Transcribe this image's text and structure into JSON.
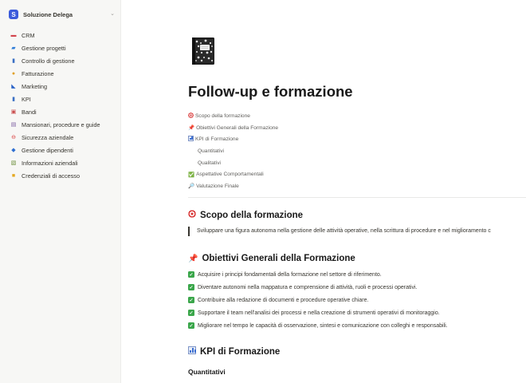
{
  "sidebar": {
    "workspace_name": "Soluzione Delega",
    "workspace_logo": "S",
    "items": [
      {
        "icon": "red-box-icon",
        "label": "CRM",
        "glyph": "▬",
        "color": "#d1434b"
      },
      {
        "icon": "folder-icon",
        "label": "Gestione progetti",
        "glyph": "▰",
        "color": "#2f7dd8"
      },
      {
        "icon": "chart-icon",
        "label": "Controllo di gestione",
        "glyph": "▮",
        "color": "#3a6fc4"
      },
      {
        "icon": "money-bag-icon",
        "label": "Fatturazione",
        "glyph": "●",
        "color": "#e0a12a"
      },
      {
        "icon": "megaphone-icon",
        "label": "Marketing",
        "glyph": "◣",
        "color": "#2b63c7"
      },
      {
        "icon": "bar-chart-icon",
        "label": "KPI",
        "glyph": "▮",
        "color": "#3a6fc4"
      },
      {
        "icon": "calendar-icon",
        "label": "Bandi",
        "glyph": "▣",
        "color": "#c94b4b"
      },
      {
        "icon": "book-icon",
        "label": "Mansionari, procedure e guide",
        "glyph": "▤",
        "color": "#7a5a9e"
      },
      {
        "icon": "no-entry-icon",
        "label": "Sicurezza aziendale",
        "glyph": "⊖",
        "color": "#d93b3b"
      },
      {
        "icon": "people-icon",
        "label": "Gestione dipendenti",
        "glyph": "◆",
        "color": "#2f6fd1"
      },
      {
        "icon": "memo-icon",
        "label": "Informazioni aziendali",
        "glyph": "▧",
        "color": "#6b8e3a"
      },
      {
        "icon": "lock-icon",
        "label": "Credenziali di accesso",
        "glyph": "■",
        "color": "#e4a821"
      }
    ]
  },
  "page": {
    "icon": "composition-notebook-icon",
    "title": "Follow-up e formazione",
    "toc": [
      {
        "label": "Scopo della formazione",
        "emoji": "target",
        "sub": false
      },
      {
        "label": "Obiettivi Generali della Formazione",
        "emoji": "📌",
        "sub": false
      },
      {
        "label": "KPI di Formazione",
        "emoji": "chart",
        "sub": false
      },
      {
        "label": "Quantitativi",
        "emoji": "",
        "sub": true
      },
      {
        "label": "Qualitativi",
        "emoji": "",
        "sub": true
      },
      {
        "label": "Aspettative Comportamentali",
        "emoji": "✅",
        "sub": false
      },
      {
        "label": "Valutazione Finale",
        "emoji": "🔎",
        "sub": false
      }
    ],
    "section1_title": "Scopo della formazione",
    "section1_quote": "Sviluppare una figura autonoma nella gestione delle attività operative, nella scrittura di procedure e nel miglioramento c",
    "section2_emoji": "📌",
    "section2_title": "Obiettivi Generali della Formazione",
    "objectives": [
      "Acquisire i principi fondamentali della formazione nel settore di riferimento.",
      "Diventare autonomi nella mappatura e comprensione di attività, ruoli e processi operativi.",
      "Contribuire alla redazione di documenti e procedure operative chiare.",
      "Supportare il team nell'analisi dei processi e nella creazione di strumenti operativi di monitoraggio.",
      "Migliorare nel tempo le capacità di osservazione, sintesi e comunicazione con colleghi e responsabili."
    ],
    "section3_title": "KPI di Formazione",
    "subsection_title": "Quantitativi"
  },
  "colors": {
    "sidebar_bg": "#f7f7f5",
    "check_green": "#3aa64a",
    "accent": "#3b5bdb"
  }
}
